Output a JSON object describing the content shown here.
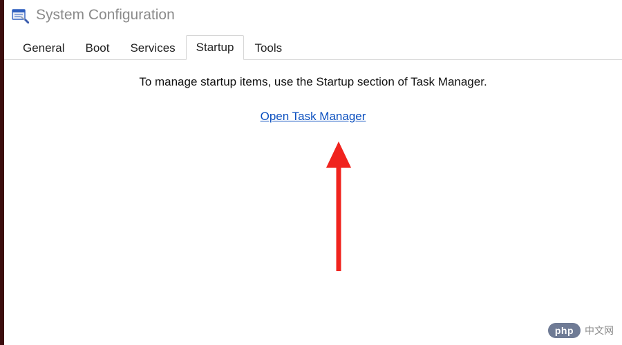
{
  "window": {
    "title": "System Configuration"
  },
  "tabs": {
    "items": [
      "General",
      "Boot",
      "Services",
      "Startup",
      "Tools"
    ],
    "activeIndex": 3
  },
  "content": {
    "info_text": "To manage startup items, use the Startup section of Task Manager.",
    "link_text": "Open Task Manager"
  },
  "watermark": {
    "pill": "php",
    "site": "中文网"
  },
  "colors": {
    "accent_link": "#0a4fbf",
    "arrow_red": "#f0231e",
    "title_gray": "#8a8a8a"
  }
}
